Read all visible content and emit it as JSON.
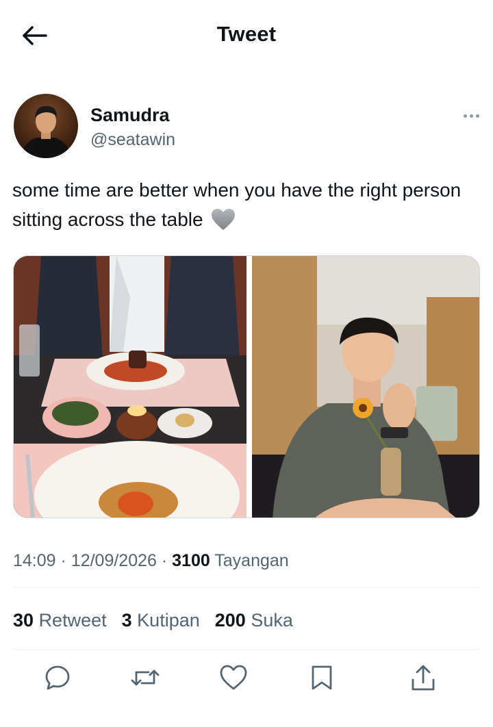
{
  "header": {
    "title": "Tweet",
    "back_icon": "arrow-left-icon"
  },
  "author": {
    "display_name": "Samudra",
    "handle": "@seatawin",
    "more_icon": "more-horizontal-icon"
  },
  "tweet": {
    "text": "some time are better when you have the right person sitting across the table",
    "emoji": "grey-heart-emoji",
    "media": [
      {
        "description_icon": "photo-dinner-table"
      },
      {
        "description_icon": "photo-man-smiling-restaurant"
      }
    ]
  },
  "meta": {
    "time": "14:09",
    "date": "12/09/2026",
    "views_count": "3100",
    "views_label": "Tayangan",
    "separator": "·"
  },
  "stats": {
    "retweets_count": "30",
    "retweets_label": "Retweet",
    "quotes_count": "3",
    "quotes_label": "Kutipan",
    "likes_count": "200",
    "likes_label": "Suka"
  },
  "actions": [
    "reply-icon",
    "retweet-icon",
    "like-icon",
    "bookmark-icon",
    "share-icon"
  ],
  "colors": {
    "text": "#0f1419",
    "secondary": "#536471",
    "divider": "#eff3f4",
    "border": "#cfd9de"
  }
}
